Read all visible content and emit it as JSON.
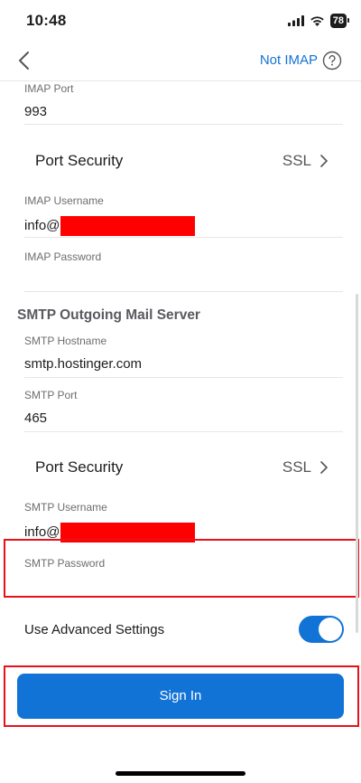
{
  "status": {
    "time": "10:48",
    "battery": "78"
  },
  "nav": {
    "not_imap": "Not IMAP"
  },
  "imap": {
    "port_label": "IMAP Port",
    "port_value": "993",
    "security_label": "Port Security",
    "security_value": "SSL",
    "username_label": "IMAP Username",
    "username_value": "info@",
    "password_label": "IMAP Password"
  },
  "smtp": {
    "section_title": "SMTP Outgoing Mail Server",
    "hostname_label": "SMTP Hostname",
    "hostname_value": "smtp.hostinger.com",
    "port_label": "SMTP Port",
    "port_value": "465",
    "security_label": "Port Security",
    "security_value": "SSL",
    "username_label": "SMTP Username",
    "username_value": "info@",
    "password_label": "SMTP Password"
  },
  "advanced": {
    "label": "Use Advanced Settings",
    "enabled": true
  },
  "sign_in": {
    "label": "Sign In"
  },
  "colors": {
    "accent": "#1273d6",
    "highlight": "#e8111c",
    "redaction": "#ff0000"
  }
}
